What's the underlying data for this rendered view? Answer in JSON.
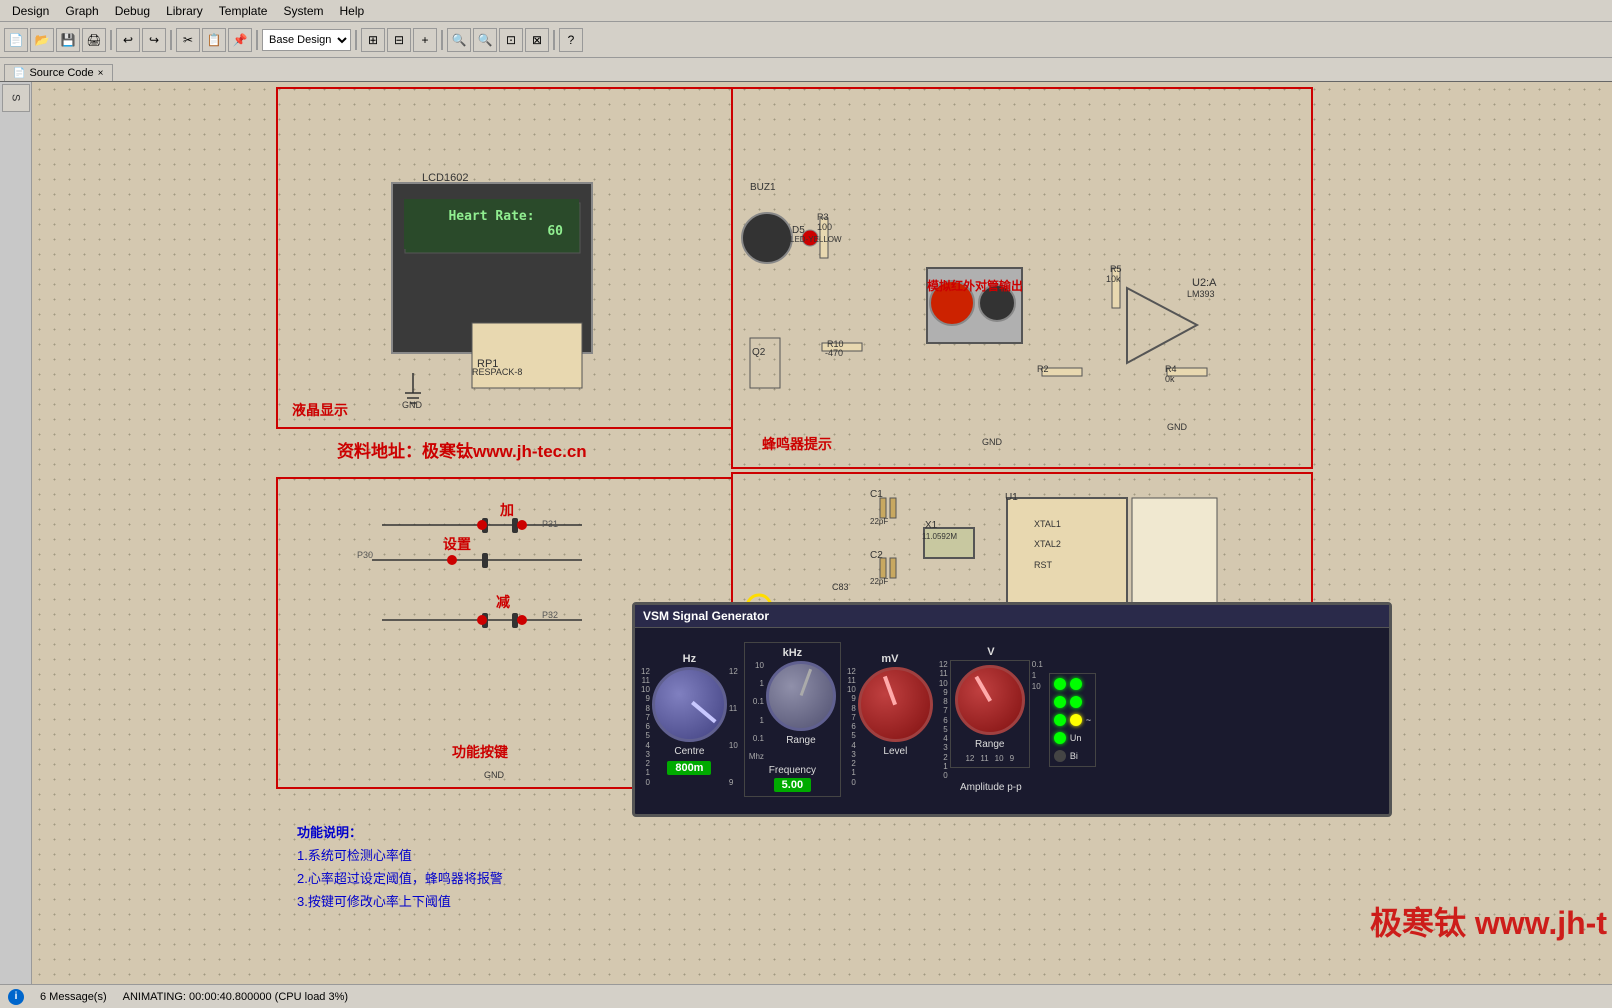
{
  "menubar": {
    "items": [
      "Design",
      "Graph",
      "Debug",
      "Library",
      "Template",
      "System",
      "Help"
    ]
  },
  "toolbar": {
    "dropdown": "Base Design",
    "buttons": [
      "new",
      "open",
      "save",
      "print",
      "cut",
      "copy",
      "paste",
      "undo",
      "redo",
      "zoom-in",
      "zoom-out",
      "fit",
      "help"
    ]
  },
  "tabs": [
    {
      "label": "Source Code",
      "active": false,
      "closable": true
    },
    {
      "label": "",
      "active": true,
      "closable": false
    }
  ],
  "schematic": {
    "sections": {
      "lcd": {
        "label": "液晶显示",
        "component_label": "LCD1602",
        "display_line1": "Heart Rate:",
        "display_line2": "   60"
      },
      "buzzer": {
        "label": "蜂鸣器提示"
      },
      "ir": {
        "label": "模拟红外对管输出"
      },
      "buttons": {
        "label": "功能按键",
        "btn_labels": [
          "加",
          "减",
          "设置"
        ]
      },
      "mcu": {
        "label": "U1"
      }
    },
    "annotation_link": "资料地址：极寒钛www.jh-tec.cn",
    "description": {
      "title": "功能说明：",
      "lines": [
        "1.系统可检测心率值",
        "2.心率超过设定阈值，蜂鸣器将报警",
        "3.按键可修改心率上下阈值"
      ]
    },
    "watermark": "极寒钛 www.jh-t"
  },
  "vsm": {
    "title": "VSM Signal Generator",
    "sections": {
      "centre": {
        "unit": "Hz",
        "label": "Centre",
        "value": "800m",
        "scale_left": [
          "9",
          "8",
          "7",
          "6",
          "5",
          "4",
          "3",
          "2",
          "1",
          "0"
        ],
        "scale_right": [
          "11",
          "10",
          "10",
          "9"
        ]
      },
      "frequency": {
        "unit": "kHz",
        "label": "Frequency",
        "range_label": "Range",
        "value": "5.00",
        "scale": [
          "10",
          "1",
          "0.1",
          "1",
          "0.1",
          "Mhz"
        ],
        "sub_label": "5.00"
      },
      "level": {
        "unit": "mV",
        "label": "Level",
        "scale": [
          "9",
          "8",
          "7",
          "6",
          "5",
          "4",
          "3",
          "2",
          "1",
          "0"
        ]
      },
      "amplitude": {
        "unit": "V",
        "label": "Amplitude p-p",
        "range_label": "Range",
        "scale_right": [
          "12",
          "11",
          "10",
          "9"
        ]
      }
    },
    "leds": [
      {
        "color": "green",
        "label": ""
      },
      {
        "color": "green",
        "label": ""
      },
      {
        "color": "green",
        "label": ""
      },
      {
        "color": "yellow",
        "label": "~"
      },
      {
        "color": "green",
        "label": "Un"
      },
      {
        "color": "off",
        "label": "Bi"
      }
    ]
  },
  "statusbar": {
    "messages": "6 Message(s)",
    "animation": "ANIMATING: 00:00:40.800000 (CPU load 3%)"
  },
  "left_panel": {
    "items": [
      "S"
    ]
  }
}
